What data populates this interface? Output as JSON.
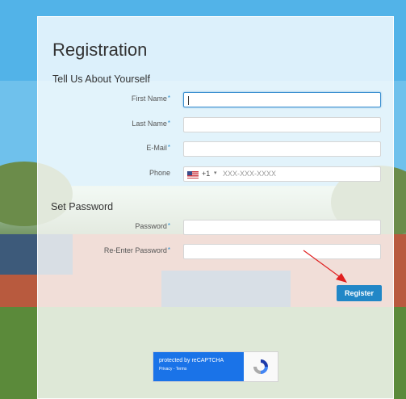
{
  "page": {
    "title": "Registration",
    "section_about": "Tell Us About Yourself",
    "section_password": "Set Password"
  },
  "fields": {
    "first_name": {
      "label": "First Name",
      "required_mark": "*",
      "value": ""
    },
    "last_name": {
      "label": "Last Name",
      "required_mark": "*",
      "value": ""
    },
    "email": {
      "label": "E-Mail",
      "required_mark": "*",
      "value": ""
    },
    "phone": {
      "label": "Phone",
      "country_code": "+1",
      "caret": "▾",
      "placeholder": "XXX-XXX-XXXX"
    },
    "password": {
      "label": "Password",
      "required_mark": "*",
      "value": ""
    },
    "re_password": {
      "label": "Re-Enter Password",
      "required_mark": "*",
      "value": ""
    }
  },
  "actions": {
    "register_label": "Register"
  },
  "recaptcha": {
    "line1": "protected by reCAPTCHA",
    "links": "Privacy - Terms"
  },
  "colors": {
    "accent": "#2187c7",
    "focus_border": "#3a8fd0",
    "arrow": "#e02020"
  }
}
